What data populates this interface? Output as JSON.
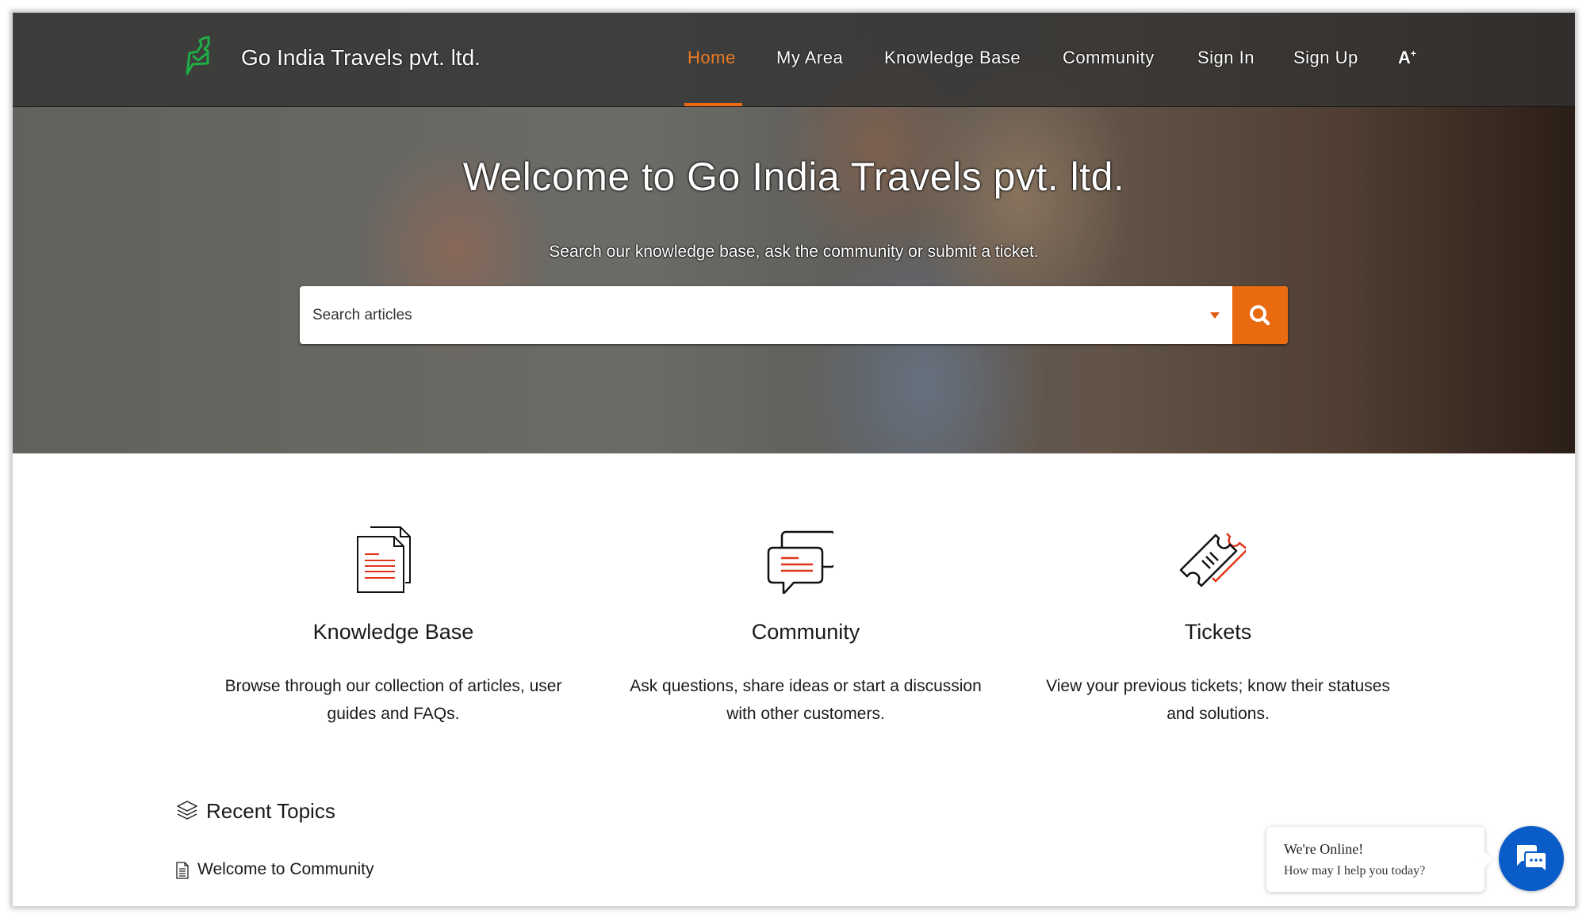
{
  "header": {
    "brand_name": "Go India Travels pvt. ltd.",
    "logo_icon": "chat-check-logo-icon",
    "nav": [
      {
        "label": "Home",
        "active": true
      },
      {
        "label": "My Area",
        "active": false
      },
      {
        "label": "Knowledge Base",
        "active": false
      },
      {
        "label": "Community",
        "active": false
      },
      {
        "label": "Sign In",
        "active": false
      },
      {
        "label": "Sign Up",
        "active": false
      }
    ],
    "font_size_toggle": {
      "label": "A",
      "superscript": "+"
    },
    "accent_color": "#ec6a14"
  },
  "hero": {
    "title": "Welcome to Go India Travels pvt. ltd.",
    "subtitle": "Search our knowledge base, ask the community or submit a ticket.",
    "search": {
      "placeholder": "Search articles",
      "value": "",
      "dropdown_icon": "caret-down-icon",
      "button_icon": "search-icon",
      "button_color": "#ea6a10"
    }
  },
  "features": [
    {
      "icon": "documents-icon",
      "title": "Knowledge Base",
      "description_lines": [
        "Browse through our collection of articles, user",
        "guides and FAQs."
      ]
    },
    {
      "icon": "chat-bubbles-icon",
      "title": "Community",
      "description_lines": [
        "Ask questions, share ideas or start a discussion",
        "with other customers."
      ]
    },
    {
      "icon": "tickets-icon",
      "title": "Tickets",
      "description_lines": [
        "View your previous tickets; know their statuses",
        "and solutions."
      ]
    }
  ],
  "recent_topics": {
    "title": "Recent Topics",
    "icon": "layers-icon",
    "items": [
      {
        "label": "Welcome to Community",
        "icon": "document-icon"
      }
    ]
  },
  "chat_widget": {
    "line1": "We're Online!",
    "line2": "How may I help you today?",
    "button_icon": "chat-icon",
    "button_color": "#0a5dc9"
  }
}
